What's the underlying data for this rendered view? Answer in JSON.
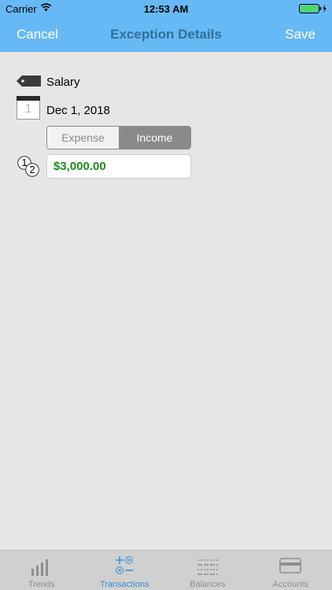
{
  "status_bar": {
    "carrier": "Carrier",
    "time": "12:53 AM"
  },
  "nav": {
    "cancel_label": "Cancel",
    "title": "Exception Details",
    "save_label": "Save"
  },
  "category": {
    "label": "Salary"
  },
  "date": {
    "label": "Dec 1, 2018",
    "calendar_day": "1"
  },
  "type_segment": {
    "options": [
      "Expense",
      "Income"
    ],
    "selected": "Income"
  },
  "amount": {
    "value": "$3,000.00",
    "badge_one": "1",
    "badge_two": "2"
  },
  "tabs": [
    {
      "label": "Trends",
      "icon": "bar-chart-icon",
      "active": false
    },
    {
      "label": "Transactions",
      "icon": "calculator-icon",
      "active": true
    },
    {
      "label": "Balances",
      "icon": "list-icon",
      "active": false
    },
    {
      "label": "Accounts",
      "icon": "credit-card-icon",
      "active": false
    }
  ],
  "colors": {
    "header": "#67b9f5",
    "accent": "#3b8fd8",
    "amount": "#1e8a1e",
    "battery": "#4cd964"
  }
}
